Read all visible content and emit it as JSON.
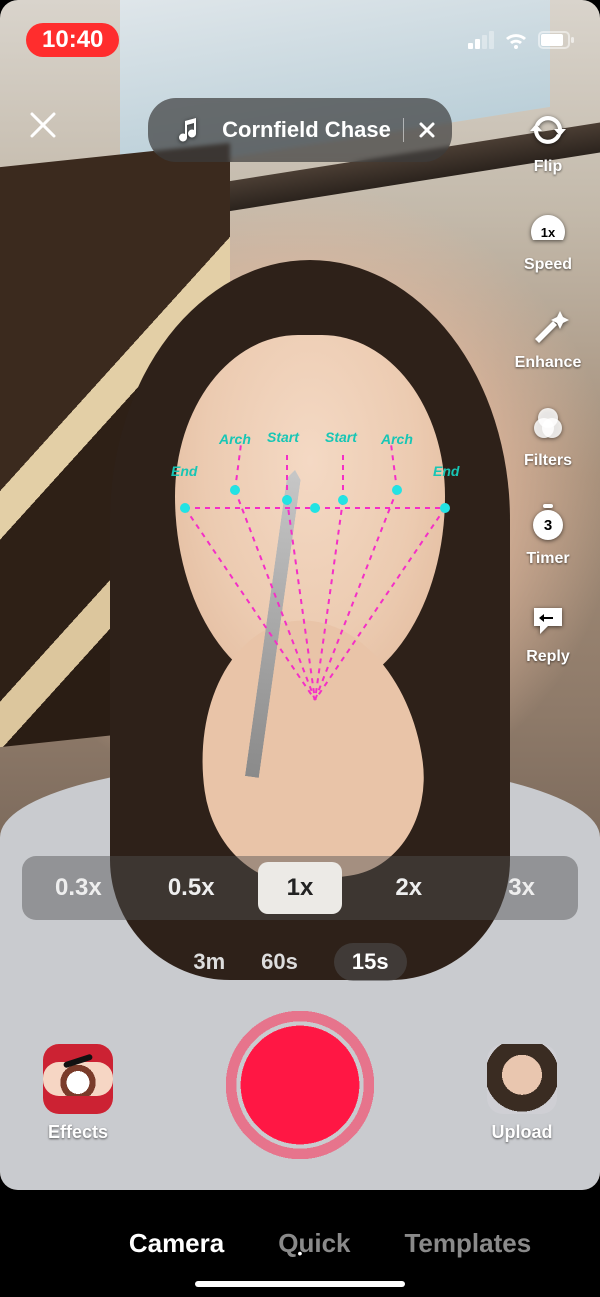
{
  "status": {
    "time": "10:40"
  },
  "topbar": {
    "sound_title": "Cornfield Chase"
  },
  "rail": {
    "flip": "Flip",
    "speed": "Speed",
    "speed_badge": "1x",
    "enhance": "Enhance",
    "filters": "Filters",
    "timer": "Timer",
    "timer_badge": "3",
    "reply": "Reply"
  },
  "zoom": {
    "options": [
      "0.3x",
      "0.5x",
      "1x",
      "2x",
      "3x"
    ],
    "selected": "1x"
  },
  "duration": {
    "options": [
      "3m",
      "60s",
      "15s"
    ],
    "selected": "15s"
  },
  "controls": {
    "effects": "Effects",
    "upload": "Upload"
  },
  "tabs": {
    "options": [
      "Camera",
      "Quick",
      "Templates"
    ],
    "selected": "Camera"
  },
  "ar_labels": {
    "end_l": "End",
    "arch_l": "Arch",
    "start_l": "Start",
    "start_r": "Start",
    "arch_r": "Arch",
    "end_r": "End"
  }
}
